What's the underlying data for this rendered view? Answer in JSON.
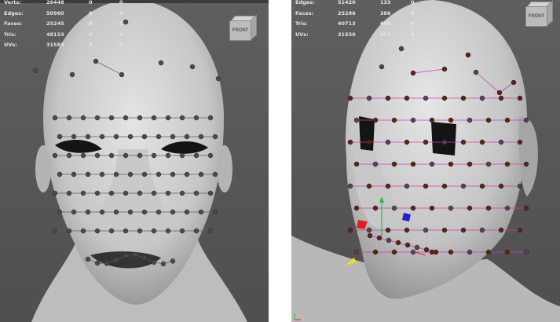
{
  "left_viewport": {
    "hud": [
      {
        "label": "Verts:",
        "v1": "26448",
        "v2": "0",
        "v3": "0"
      },
      {
        "label": "Edges:",
        "v1": "50960",
        "v2": "0",
        "v3": "0"
      },
      {
        "label": "Faces:",
        "v1": "25245",
        "v2": "0",
        "v3": "0"
      },
      {
        "label": "Tris:",
        "v1": "48153",
        "v2": "0",
        "v3": "0"
      },
      {
        "label": "UVs:",
        "v1": "31583",
        "v2": "0",
        "v3": "0"
      }
    ],
    "viewcube_label": "FRONT"
  },
  "right_viewport": {
    "hud": [
      {
        "label": "Edges:",
        "v1": "51420",
        "v2": "133",
        "v3": "0"
      },
      {
        "label": "Faces:",
        "v1": "25286",
        "v2": "386",
        "v3": "0"
      },
      {
        "label": "Tris:",
        "v1": "40713",
        "v2": "660",
        "v3": "0"
      },
      {
        "label": "UVs:",
        "v1": "31550",
        "v2": "617",
        "v3": "0"
      }
    ],
    "viewcube_label": "FRONT"
  },
  "colors": {
    "viewport_bg": "#585858",
    "head_skin": "#d2d2d2",
    "joint_gray": "#4a4a4a",
    "joint_brown": "#5a2418",
    "wire_magenta": "#c040c0",
    "wire_black": "#202020",
    "manip_green": "#20c040",
    "manip_red": "#e02020",
    "manip_blue": "#2020d0",
    "manip_yellow": "#f0e020"
  }
}
